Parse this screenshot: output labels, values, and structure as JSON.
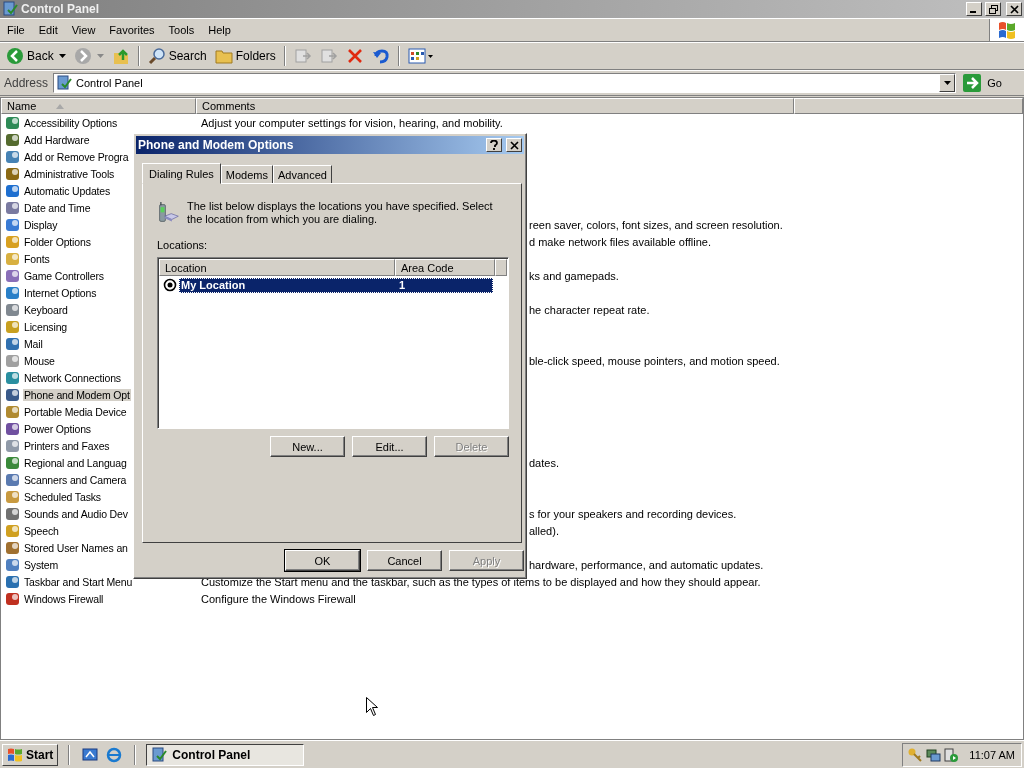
{
  "window": {
    "title": "Control Panel"
  },
  "menu": [
    "File",
    "Edit",
    "View",
    "Favorites",
    "Tools",
    "Help"
  ],
  "toolbar": [
    {
      "kind": "back",
      "label": "Back",
      "disabled": false
    },
    {
      "kind": "forward",
      "disabled": true
    },
    {
      "kind": "up",
      "disabled": false
    },
    {
      "kind": "search",
      "label": "Search",
      "disabled": false
    },
    {
      "kind": "folders",
      "label": "Folders",
      "disabled": false
    },
    {
      "kind": "move",
      "disabled": true
    },
    {
      "kind": "copy",
      "disabled": true
    },
    {
      "kind": "delete",
      "disabled": false
    },
    {
      "kind": "undo",
      "disabled": false
    },
    {
      "kind": "views",
      "disabled": false
    }
  ],
  "address": {
    "label": "Address",
    "value": "Control Panel",
    "go": "Go"
  },
  "columns": [
    "Name",
    "Comments"
  ],
  "items": [
    {
      "name": "Accessibility Options",
      "selected": false,
      "comment": "Adjust your computer settings for vision, hearing, and mobility."
    },
    {
      "name": "Add Hardware",
      "selected": false
    },
    {
      "name": "Add or Remove Progra",
      "selected": false
    },
    {
      "name": "Administrative Tools",
      "selected": false
    },
    {
      "name": "Automatic Updates",
      "selected": false
    },
    {
      "name": "Date and Time",
      "selected": false
    },
    {
      "name": "Display",
      "selected": false,
      "comment": "reen saver, colors, font sizes, and screen resolution.",
      "behind_dialog": true
    },
    {
      "name": "Folder Options",
      "selected": false,
      "comment": "d make network files available offline.",
      "behind_dialog": true
    },
    {
      "name": "Fonts",
      "selected": false
    },
    {
      "name": "Game Controllers",
      "selected": false,
      "comment": "ks and gamepads.",
      "behind_dialog": true
    },
    {
      "name": "Internet Options",
      "selected": false
    },
    {
      "name": "Keyboard",
      "selected": false,
      "comment": "he character repeat rate.",
      "behind_dialog": true
    },
    {
      "name": "Licensing",
      "selected": false
    },
    {
      "name": "Mail",
      "selected": false
    },
    {
      "name": "Mouse",
      "selected": false,
      "comment": "ble-click speed, mouse pointers, and motion speed.",
      "behind_dialog": true
    },
    {
      "name": "Network Connections",
      "selected": false
    },
    {
      "name": "Phone and Modem Opt",
      "selected": true
    },
    {
      "name": "Portable Media Device",
      "selected": false
    },
    {
      "name": "Power Options",
      "selected": false
    },
    {
      "name": "Printers and Faxes",
      "selected": false
    },
    {
      "name": "Regional and Languag",
      "selected": false,
      "comment": "dates.",
      "behind_dialog": true
    },
    {
      "name": "Scanners and Camera",
      "selected": false
    },
    {
      "name": "Scheduled Tasks",
      "selected": false
    },
    {
      "name": "Sounds and Audio Dev",
      "selected": false,
      "comment": "s for your speakers and recording devices.",
      "behind_dialog": true
    },
    {
      "name": "Speech",
      "selected": false,
      "comment": "alled).",
      "behind_dialog": true
    },
    {
      "name": "Stored User Names an",
      "selected": false
    },
    {
      "name": "System",
      "selected": false,
      "comment": "hardware, performance, and automatic updates.",
      "behind_dialog": true
    },
    {
      "name": "Taskbar and Start Menu",
      "selected": false,
      "comment": "Customize the Start menu and the taskbar, such as the types of items to be displayed and how they should appear."
    },
    {
      "name": "Windows Firewall",
      "selected": false,
      "comment": "Configure the Windows Firewall"
    }
  ],
  "dialog": {
    "title": "Phone and Modem Options",
    "tabs": [
      {
        "label": "Dialing Rules",
        "selected": true
      },
      {
        "label": "Modems",
        "selected": false
      },
      {
        "label": "Advanced",
        "selected": false
      }
    ],
    "description": "The list below displays the locations you have specified. Select the location from which you are dialing.",
    "locations_label": "Locations:",
    "columns": [
      "Location",
      "Area Code"
    ],
    "rows": [
      {
        "location": "My Location",
        "area_code": "1",
        "selected": true
      }
    ],
    "actions": [
      {
        "label": "New...",
        "disabled": false
      },
      {
        "label": "Edit...",
        "disabled": false
      },
      {
        "label": "Delete",
        "disabled": true
      }
    ],
    "buttons": [
      {
        "label": "OK",
        "disabled": false,
        "default": true
      },
      {
        "label": "Cancel",
        "disabled": false,
        "default": false
      },
      {
        "label": "Apply",
        "disabled": true,
        "default": false
      }
    ]
  },
  "taskbar": {
    "start": "Start",
    "tasks": [
      {
        "label": "Control Panel",
        "selected": true
      }
    ],
    "clock": "11:07 AM"
  }
}
